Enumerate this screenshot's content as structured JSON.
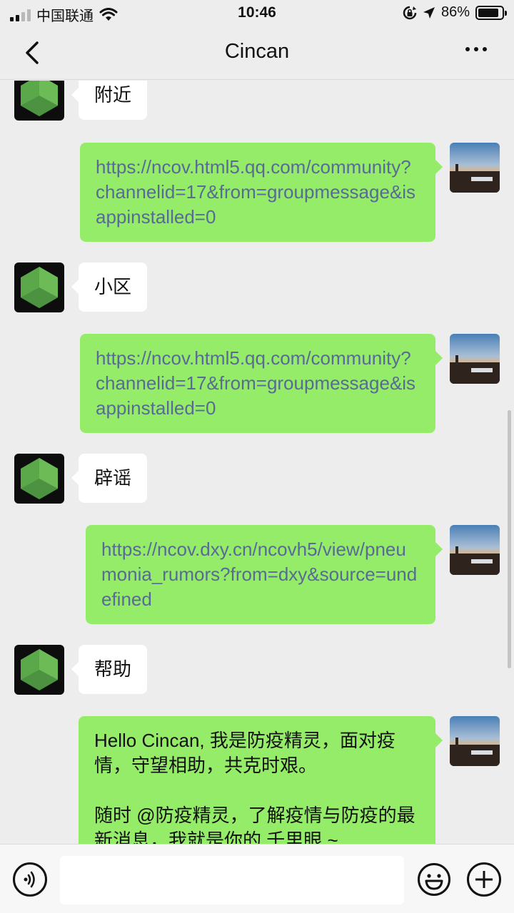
{
  "status_bar": {
    "carrier": "中国联通",
    "time": "10:46",
    "battery": "86%",
    "battery_level": 0.86
  },
  "nav": {
    "title": "Cincan"
  },
  "messages": [
    {
      "from": "bot",
      "text": "附近"
    },
    {
      "from": "me",
      "text": "https://ncov.html5.qq.com/community?channelid=17&from=groupmessage&isappinstalled=0"
    },
    {
      "from": "bot",
      "text": "小区"
    },
    {
      "from": "me",
      "text": "https://ncov.html5.qq.com/community?channelid=17&from=groupmessage&isappinstalled=0"
    },
    {
      "from": "bot",
      "text": "辟谣"
    },
    {
      "from": "me",
      "text": "https://ncov.dxy.cn/ncovh5/view/pneumonia_rumors?from=dxy&source=undefined"
    },
    {
      "from": "bot",
      "text": "帮助"
    },
    {
      "from": "me",
      "text": "Hello Cincan, 我是防疫精灵，面对疫情，守望相助，共克时艰。\n\n随时 @防疫精灵，了解疫情与防疫的最新消息，我就是你的 千里眼 ~"
    }
  ],
  "colors": {
    "background": "#ededed",
    "outgoing_bubble": "#95ec69",
    "incoming_bubble": "#ffffff",
    "link": "#576b95"
  }
}
